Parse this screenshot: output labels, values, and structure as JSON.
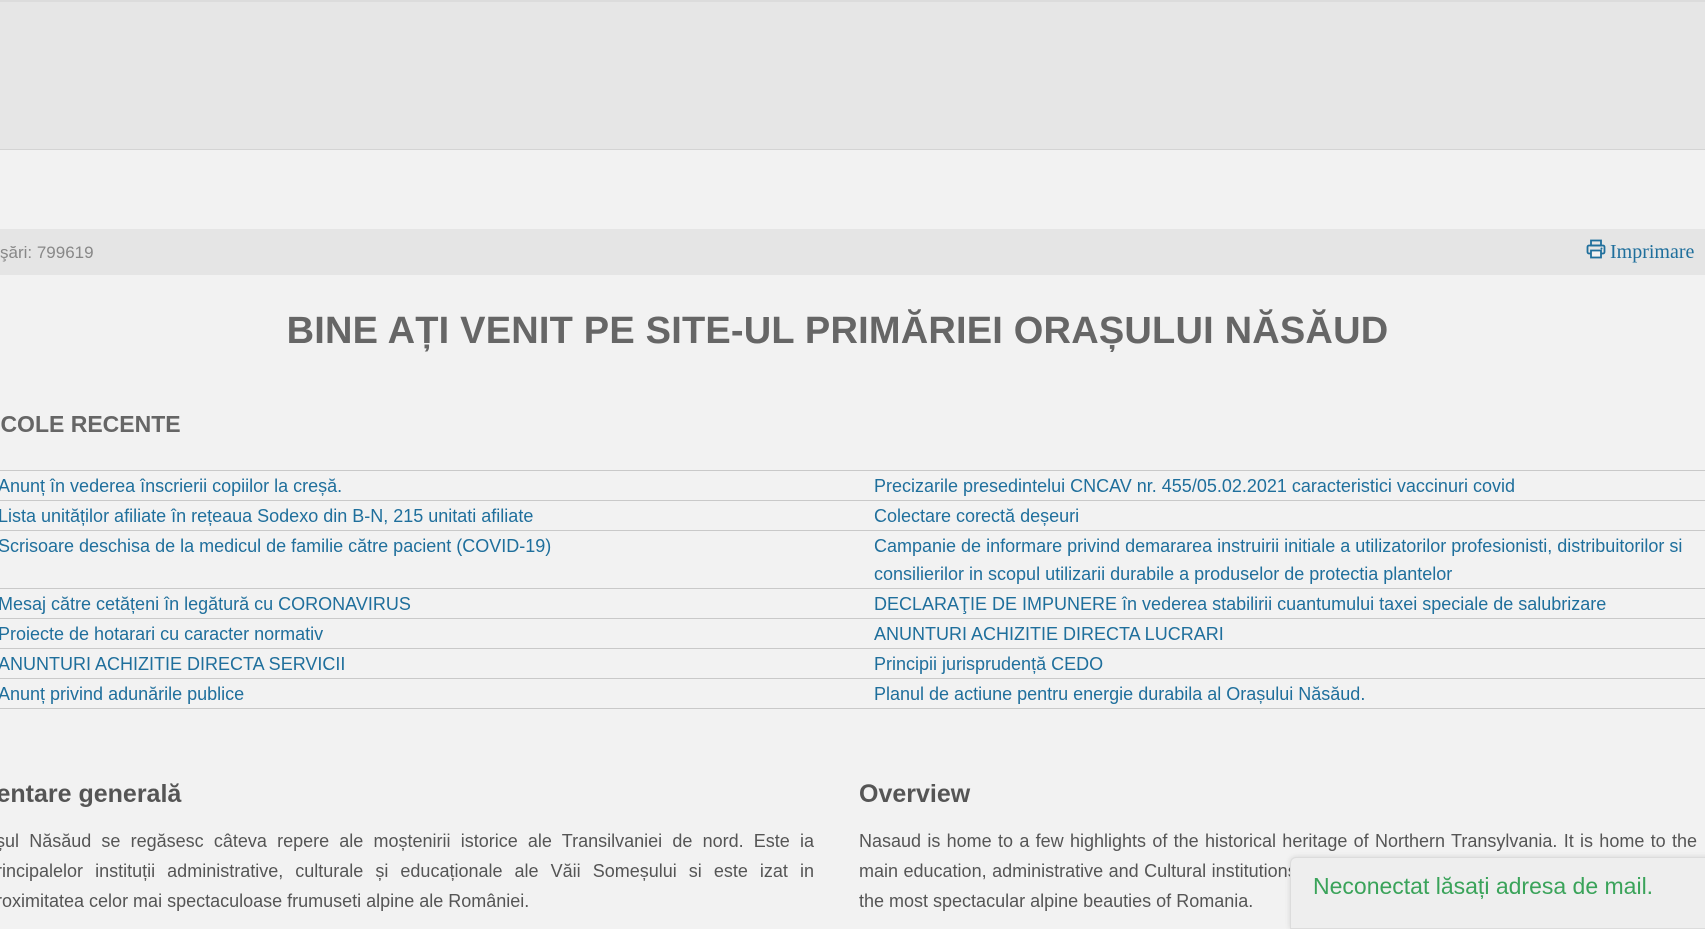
{
  "header": {
    "visits_label": "şări: 799619",
    "print_label": "Imprimare",
    "print_icon": "printer-icon"
  },
  "page_title": "BINE AȚI VENIT PE SITE-UL PRIMĂRIEI ORAȘULUI NĂSĂUD",
  "recent_articles": {
    "heading": "TICOLE RECENTE",
    "left": [
      "Anunț în vederea înscrierii copiilor la creșă.",
      "Lista unităților afiliate în rețeaua Sodexo din B-N, 215 unitati afiliate",
      "Scrisoare deschisa de la medicul de familie către pacient (COVID-19)",
      "Mesaj către cetățeni în legătură cu CORONAVIRUS",
      "Proiecte de hotarari cu caracter normativ",
      "ANUNTURI ACHIZITIE DIRECTA SERVICII",
      "Anunț privind adunările publice"
    ],
    "right": [
      "Precizarile presedintelui CNCAV nr. 455/05.02.2021 caracteristici vaccinuri covid",
      "Colectare corectă deșeuri",
      "Campanie de informare privind demararea instruirii initiale a utilizatorilor profesionisti, distribuitorilor si consilierilor in scopul utilizarii durabile a produselor de protectia plantelor",
      "DECLARAŢIE DE IMPUNERE în vederea stabilirii cuantumului taxei speciale de salubrizare",
      "ANUNTURI ACHIZITIE DIRECTA LUCRARI",
      "Principii jurisprudență CEDO",
      "Planul de actiune pentru energie durabila al Orașului Năsăud."
    ]
  },
  "intro": {
    "heading": "zentare generală",
    "text": "așul Năsăud se regăsesc câteva repere ale moștenirii istorice ale Transilvaniei de nord. Este ia principalelor instituții administrative, culturale și educaționale ale Văii Someșului si este izat in proximitatea celor mai spectaculoase frumuseti alpine ale României."
  },
  "overview": {
    "heading": "Overview",
    "text": "Nasaud is home to a few highlights of the historical heritage of Northern Transylvania. It is home to the main education, administrative and Cultural institutions of the Somes Valley and it is within easy reach of the most spectacular alpine beauties of Romania."
  },
  "chat": {
    "status_text": "Neconectat lăsați adresa de mail.",
    "accent": "#3aa35a"
  }
}
